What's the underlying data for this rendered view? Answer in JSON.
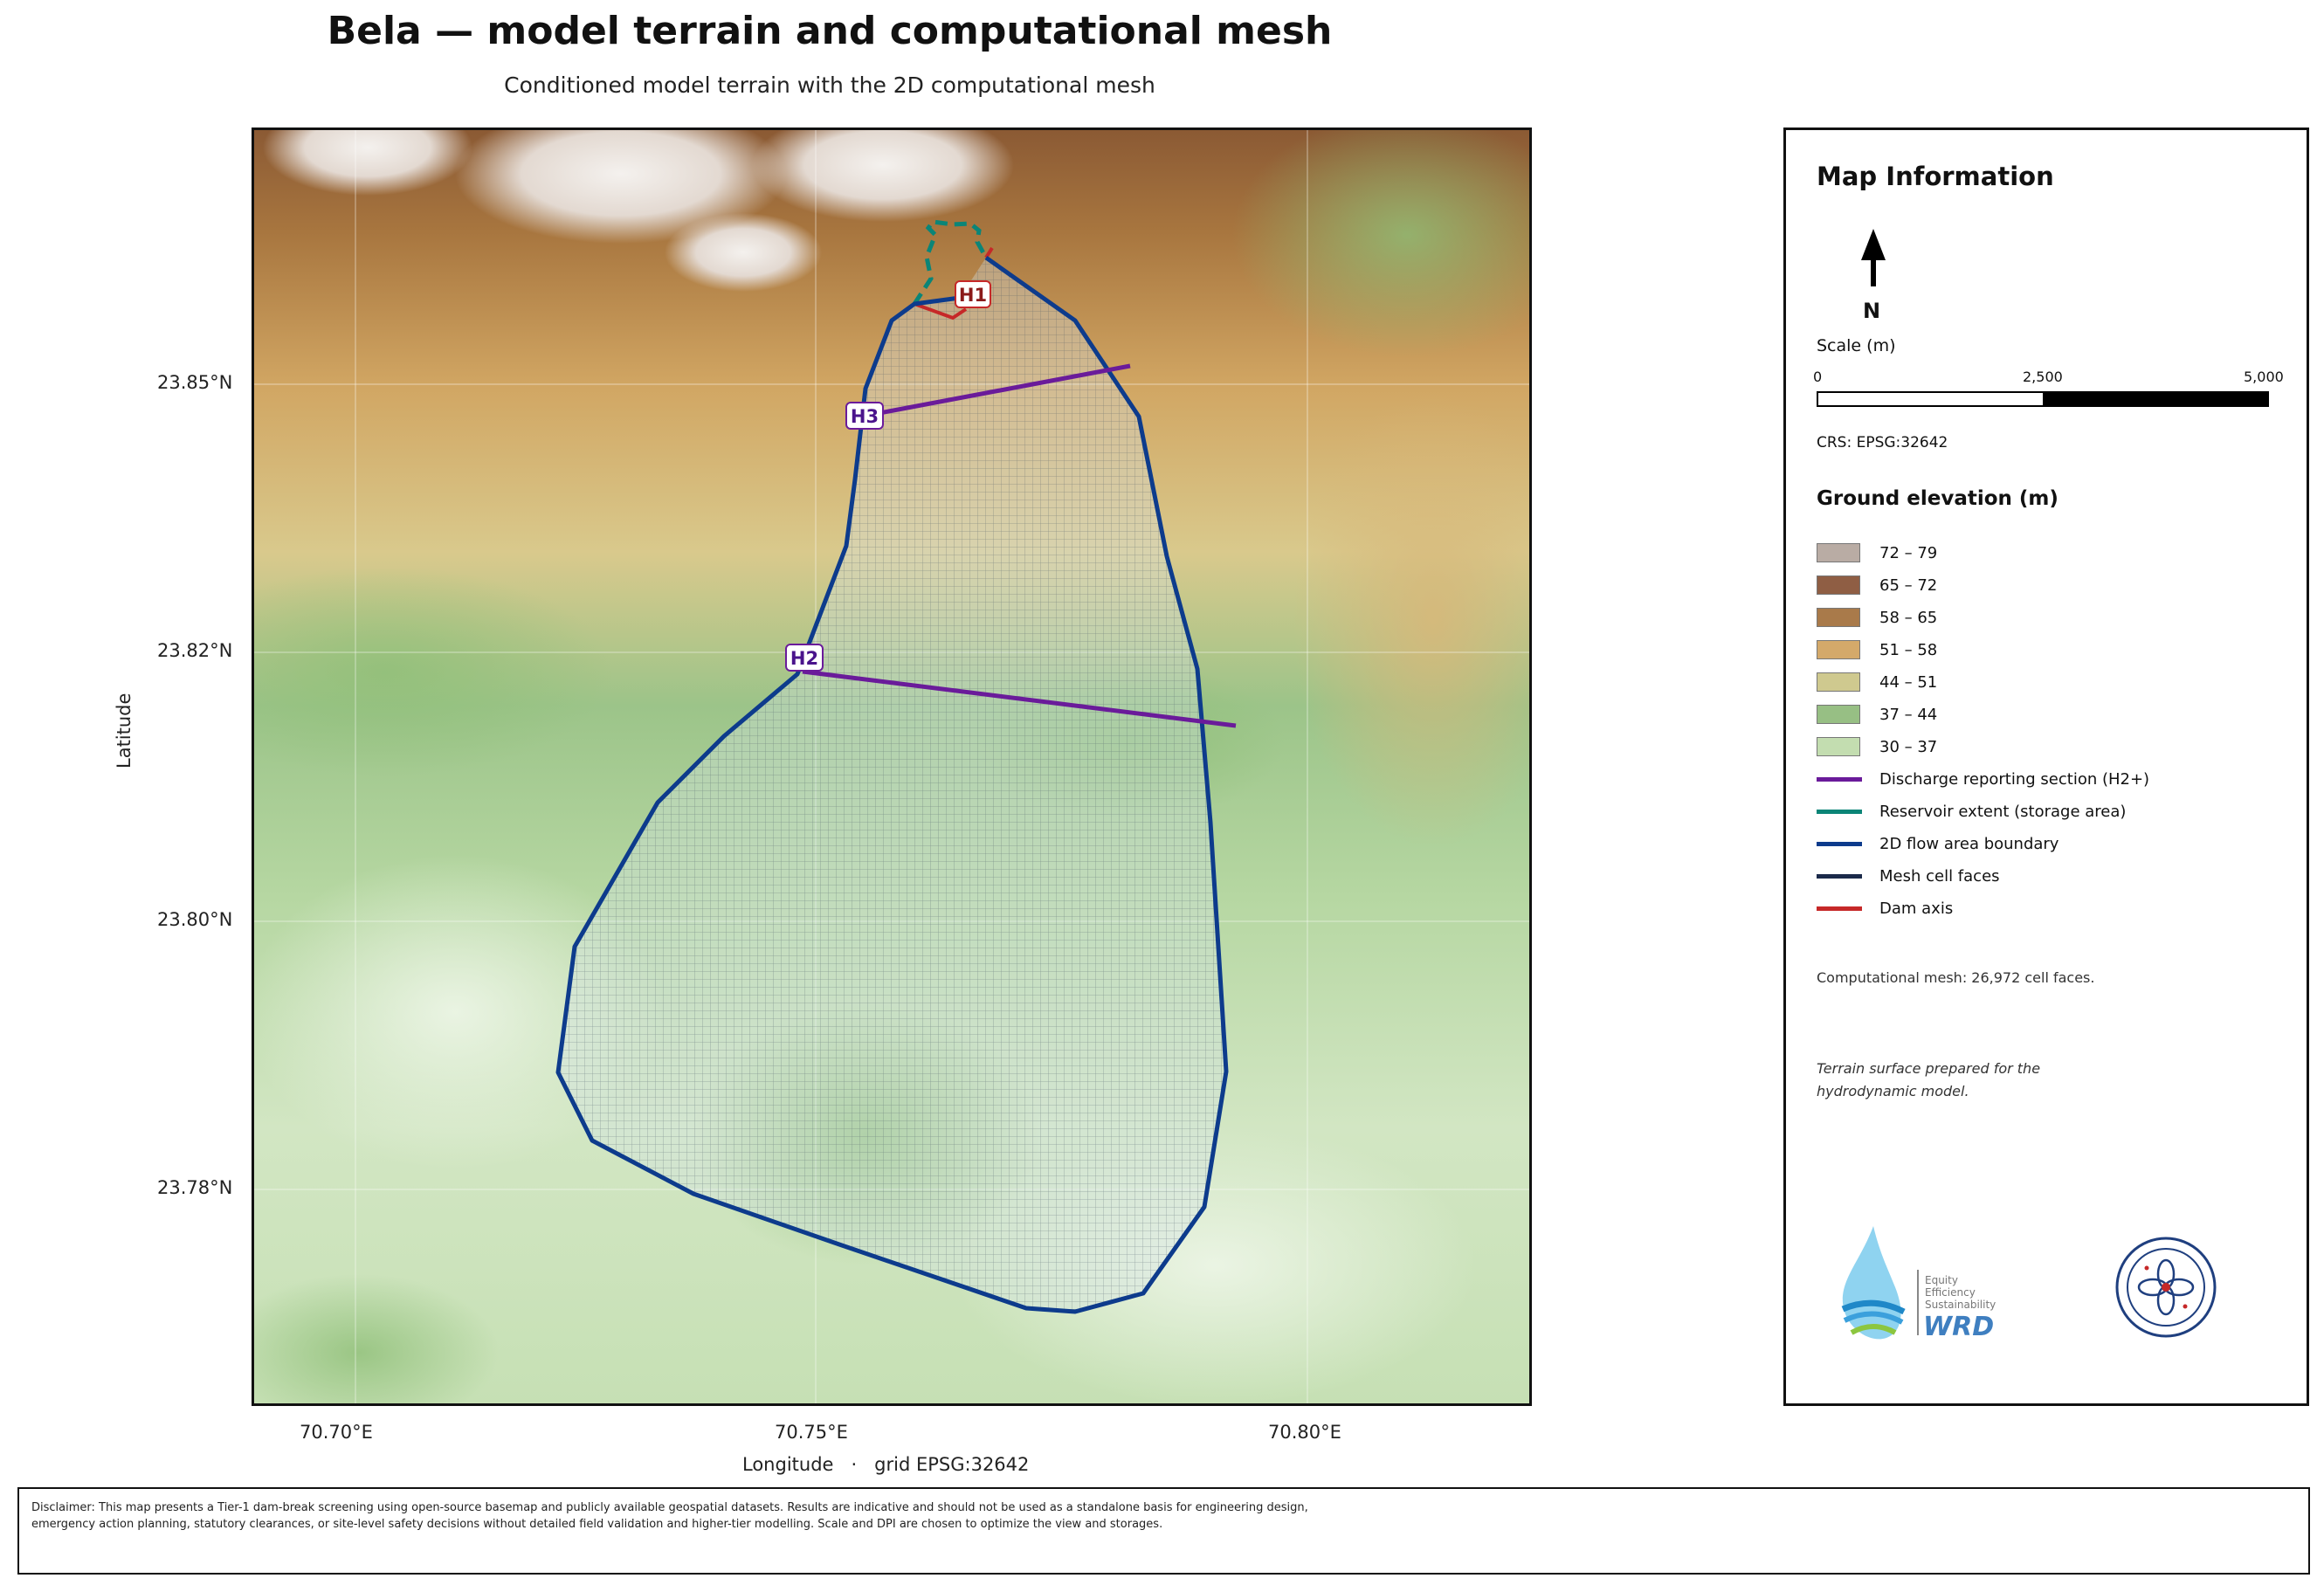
{
  "title": "Bela — model terrain and computational mesh",
  "subtitle": "Conditioned model terrain with the 2D computational mesh",
  "axes": {
    "y_ticks": [
      "23.85°N",
      "23.82°N",
      "23.80°N",
      "23.78°N"
    ],
    "x_ticks": [
      "70.70°E",
      "70.75°E",
      "70.80°E"
    ],
    "ylabel": "Latitude",
    "xlabel": "Longitude   ·   grid EPSG:32642"
  },
  "sections": {
    "h1": "H1",
    "h2": "H2",
    "h3": "H3"
  },
  "panel": {
    "title": "Map Information",
    "north": "N",
    "scale_title": "Scale (m)",
    "scale_labels": [
      "0",
      "2,500",
      "5,000"
    ],
    "crs": "CRS: EPSG:32642",
    "legend_title": "Ground elevation (m)",
    "elevation_classes": [
      {
        "label": "72 – 79",
        "color": "#b9aca4"
      },
      {
        "label": "65 – 72",
        "color": "#8f5e44"
      },
      {
        "label": "58 – 65",
        "color": "#a97a4a"
      },
      {
        "label": "51 – 58",
        "color": "#d4a96a"
      },
      {
        "label": "44 – 51",
        "color": "#cfc98f"
      },
      {
        "label": "37 – 44",
        "color": "#97bf84"
      },
      {
        "label": "30 – 37",
        "color": "#c3ddb0"
      }
    ],
    "line_items": [
      {
        "label": "Discharge reporting section (H2+)",
        "color": "#6a1b9a"
      },
      {
        "label": "Reservoir extent (storage area)",
        "color": "#0b8577"
      },
      {
        "label": "2D flow area boundary",
        "color": "#0d3b8c"
      },
      {
        "label": "Mesh cell faces",
        "color": "#1b2a4a"
      },
      {
        "label": "Dam axis",
        "color": "#c62828"
      }
    ],
    "mesh_note": "Computational mesh: 26,972 cell faces.",
    "terrain_note": "Terrain surface prepared for the hydrodynamic model.",
    "logo_text": [
      "Equity",
      "Efficiency",
      "Sustainability",
      "WRD"
    ]
  },
  "disclaimer": "Disclaimer: This map presents a Tier-1 dam-break screening using open-source basemap and publicly available geospatial datasets. Results are indicative and should not be used as a standalone basis for engineering design, emergency action planning, statutory clearances, or site-level safety decisions without detailed field validation and higher-tier modelling. Scale and DPI are chosen to optimize the view and storages."
}
